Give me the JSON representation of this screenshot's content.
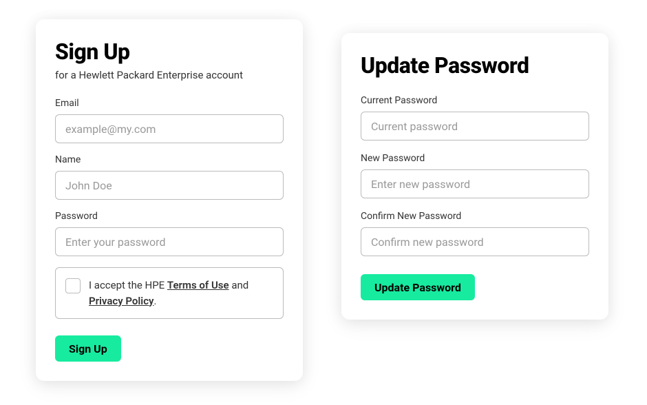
{
  "signup": {
    "title": "Sign Up",
    "subtitle": "for a Hewlett Packard Enterprise account",
    "email_label": "Email",
    "email_placeholder": "example@my.com",
    "name_label": "Name",
    "name_placeholder": "John Doe",
    "password_label": "Password",
    "password_placeholder": "Enter your password",
    "consent_prefix": "I accept the HPE ",
    "terms_link": "Terms of Use",
    "consent_mid": " and ",
    "privacy_link": "Privacy Policy",
    "consent_suffix": ".",
    "submit_label": "Sign Up"
  },
  "update": {
    "title": "Update Password",
    "current_label": "Current Password",
    "current_placeholder": "Current password",
    "new_label": "New Password",
    "new_placeholder": "Enter new password",
    "confirm_label": "Confirm New Password",
    "confirm_placeholder": "Confirm new password",
    "submit_label": "Update Password"
  },
  "colors": {
    "accent": "#17eba0"
  }
}
